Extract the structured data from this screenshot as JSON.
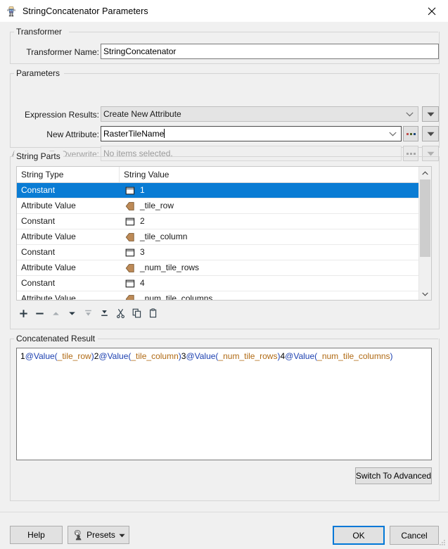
{
  "window": {
    "title": "StringConcatenator Parameters",
    "icon": "transformer-icon",
    "close_label": "✕"
  },
  "transformer": {
    "legend": "Transformer",
    "name_label": "Transformer Name:",
    "name_value": "StringConcatenator"
  },
  "parameters": {
    "legend": "Parameters",
    "expression_results_label": "Expression Results:",
    "expression_results_value": "Create New Attribute",
    "new_attribute_label": "New Attribute:",
    "new_attribute_value": "RasterTileName",
    "attributes_to_overwrite_label": "Attributes To Overwrite:",
    "attributes_to_overwrite_value": "No items selected.",
    "ellipsis_label": "...",
    "dropdown_icon": "chevron-down-icon"
  },
  "string_parts": {
    "legend": "String Parts",
    "columns": [
      "String Type",
      "String Value"
    ],
    "rows": [
      {
        "type": "Constant",
        "icon": "constant-icon",
        "value": "1",
        "selected": true
      },
      {
        "type": "Attribute Value",
        "icon": "attribute-icon",
        "value": "_tile_row",
        "selected": false
      },
      {
        "type": "Constant",
        "icon": "constant-icon",
        "value": "2",
        "selected": false
      },
      {
        "type": "Attribute Value",
        "icon": "attribute-icon",
        "value": "_tile_column",
        "selected": false
      },
      {
        "type": "Constant",
        "icon": "constant-icon",
        "value": "3",
        "selected": false
      },
      {
        "type": "Attribute Value",
        "icon": "attribute-icon",
        "value": "_num_tile_rows",
        "selected": false
      },
      {
        "type": "Constant",
        "icon": "constant-icon",
        "value": "4",
        "selected": false
      },
      {
        "type": "Attribute Value",
        "icon": "attribute-icon",
        "value": "_num_tile_columns",
        "selected": false
      }
    ],
    "toolbar": [
      {
        "name": "add-button",
        "icon": "plus-icon",
        "enabled": true
      },
      {
        "name": "remove-button",
        "icon": "minus-icon",
        "enabled": true
      },
      {
        "name": "move-up-button",
        "icon": "arrow-up-icon",
        "enabled": false
      },
      {
        "name": "move-down-button",
        "icon": "arrow-down-icon",
        "enabled": true
      },
      {
        "name": "move-to-top-button",
        "icon": "move-to-top-icon",
        "enabled": false
      },
      {
        "name": "move-to-bottom-button",
        "icon": "move-to-bottom-icon",
        "enabled": true
      },
      {
        "name": "cut-button",
        "icon": "scissors-icon",
        "enabled": true
      },
      {
        "name": "copy-button",
        "icon": "copy-icon",
        "enabled": true
      },
      {
        "name": "paste-button",
        "icon": "paste-icon",
        "enabled": true
      }
    ]
  },
  "result": {
    "legend": "Concatenated Result",
    "tokens": [
      {
        "text": "1",
        "kind": "num"
      },
      {
        "text": "@Value(",
        "kind": "fn"
      },
      {
        "text": "_tile_row",
        "kind": "attr"
      },
      {
        "text": ")",
        "kind": "fn"
      },
      {
        "text": "2",
        "kind": "num"
      },
      {
        "text": "@Value(",
        "kind": "fn"
      },
      {
        "text": "_tile_column",
        "kind": "attr"
      },
      {
        "text": ")",
        "kind": "fn"
      },
      {
        "text": "3",
        "kind": "num"
      },
      {
        "text": "@Value(",
        "kind": "fn"
      },
      {
        "text": "_num_tile_rows",
        "kind": "attr"
      },
      {
        "text": ")",
        "kind": "fn"
      },
      {
        "text": "4",
        "kind": "num"
      },
      {
        "text": "@Value(",
        "kind": "fn"
      },
      {
        "text": "_num_tile_columns",
        "kind": "attr"
      },
      {
        "text": ")",
        "kind": "fn"
      }
    ],
    "plain": "1@Value(_tile_row)2@Value(_tile_column)3@Value(_num_tile_rows)4@Value(_num_tile_columns)",
    "switch_advanced_label": "Switch To Advanced"
  },
  "footer": {
    "help_label": "Help",
    "presets_label": "Presets",
    "presets_icon": "presets-gear-person-icon",
    "ok_label": "OK",
    "cancel_label": "Cancel"
  },
  "colors": {
    "selection_blue": "#0a7cd4",
    "focus_blue": "#0078d7",
    "attribute_brown": "#b88a5a",
    "token_function": "#1b3fb0",
    "token_attribute": "#b06a14",
    "window_bg": "#f0f0f0"
  }
}
